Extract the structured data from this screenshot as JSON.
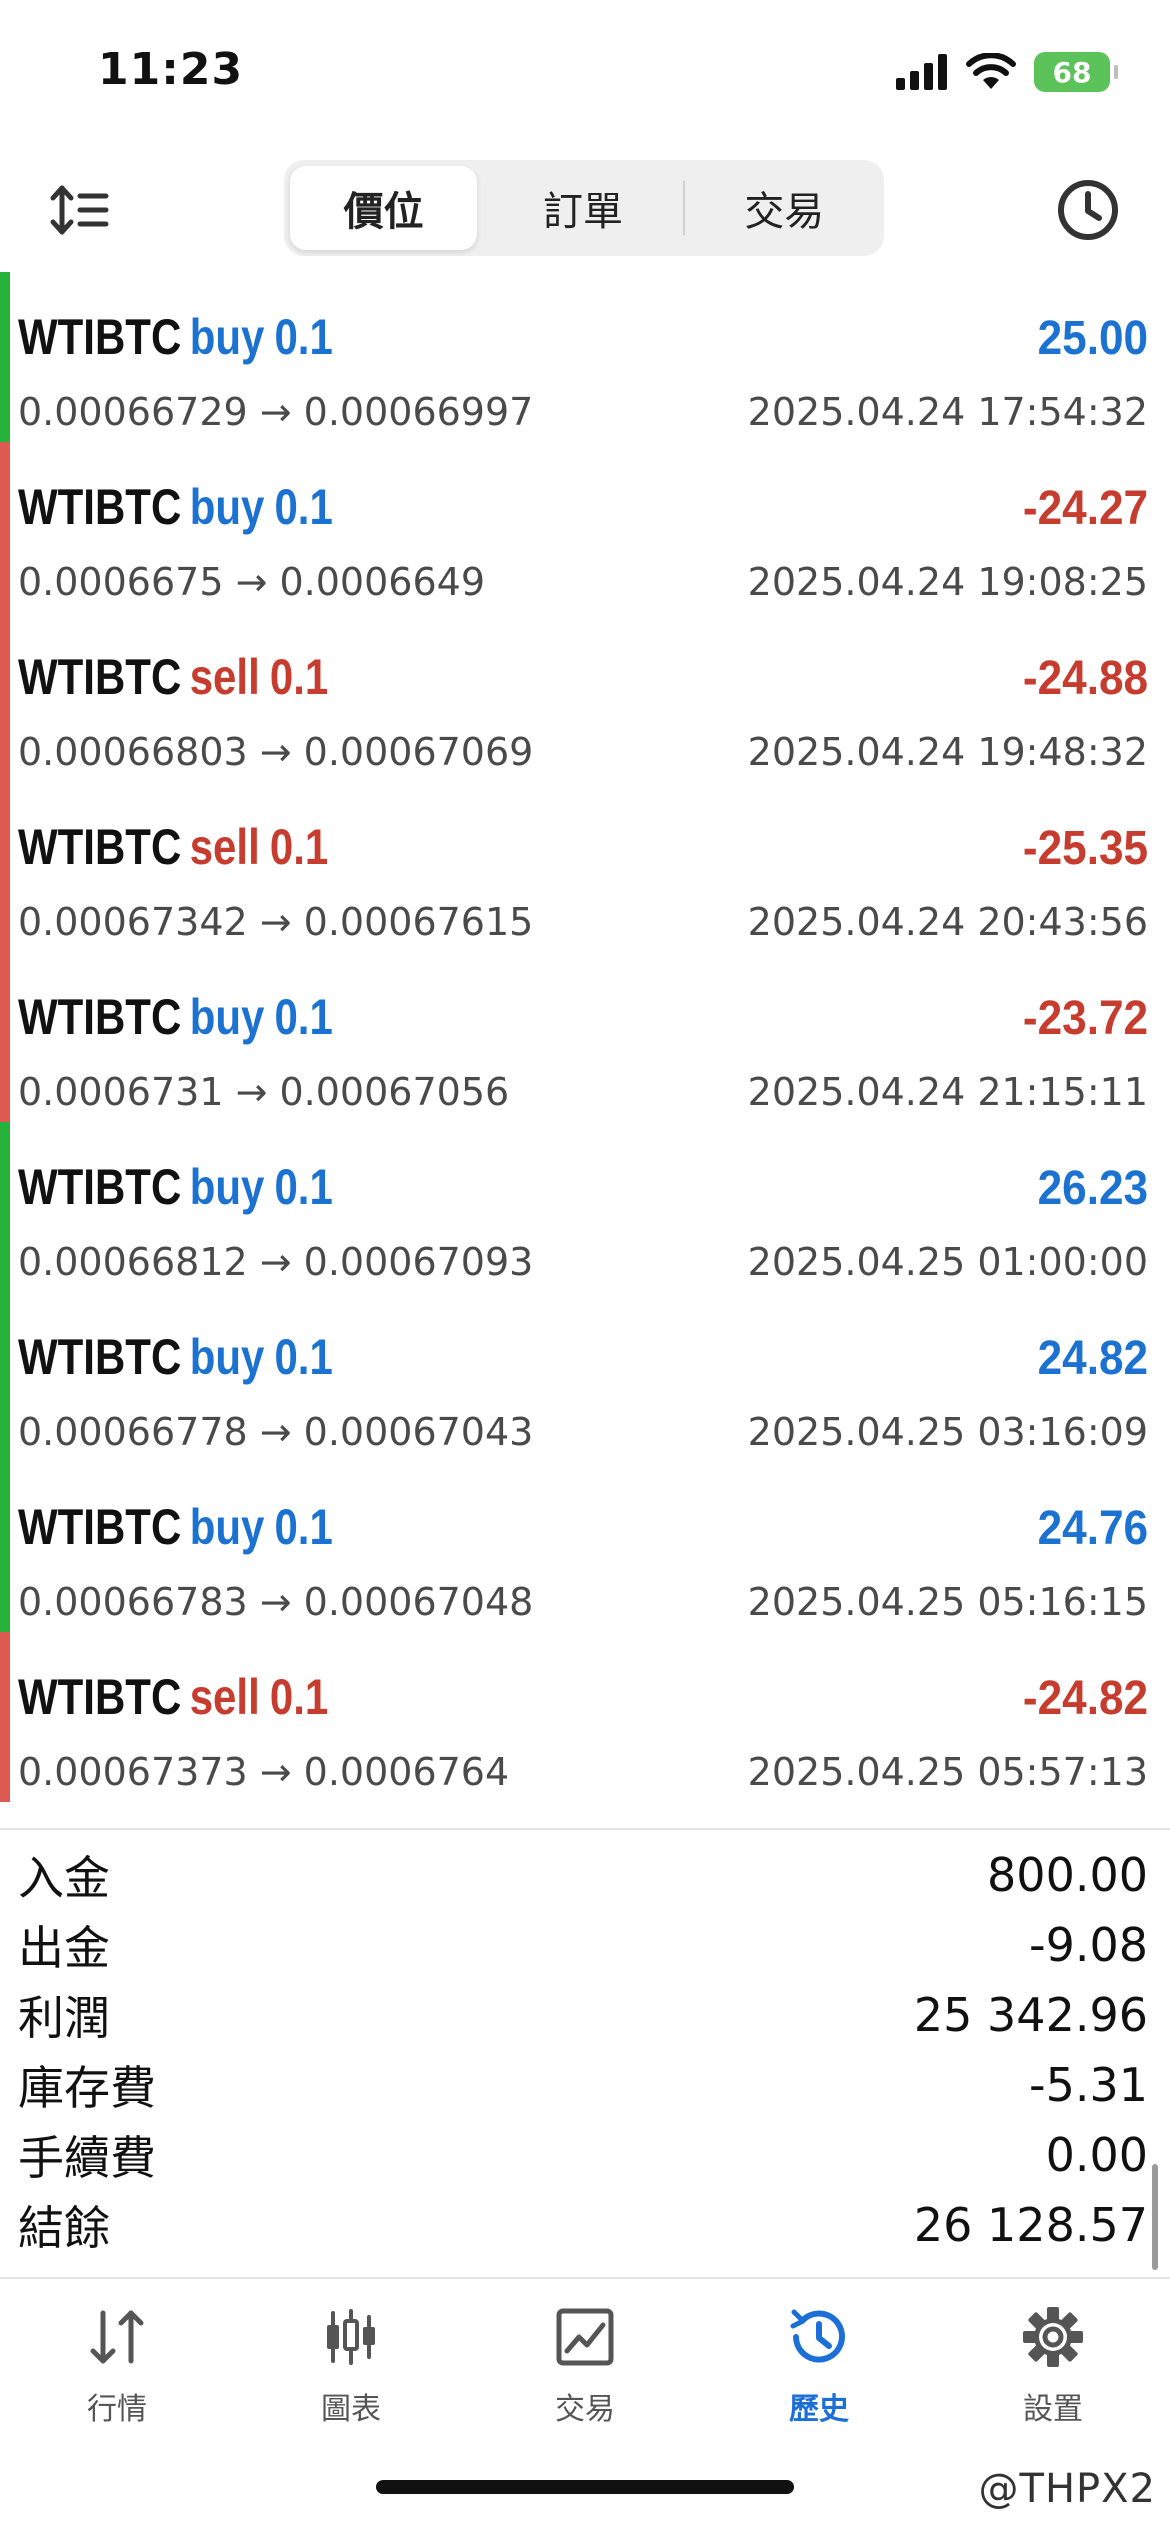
{
  "status_bar": {
    "time": "11:23",
    "battery": "68"
  },
  "tabs": [
    {
      "label": "價位",
      "active": true
    },
    {
      "label": "訂單",
      "active": false
    },
    {
      "label": "交易",
      "active": false
    }
  ],
  "colors": {
    "buy": "#1b72d1",
    "sell": "#c63c2e",
    "profit_pos": "#1b72d1",
    "profit_neg": "#c63c2e",
    "bar_green": "#27b33b",
    "bar_red": "#dc5a50"
  },
  "trades": [
    {
      "symbol": "WTIBTC",
      "side": "buy",
      "volume": "0.1",
      "profit": "25.00",
      "open": "0.00066729",
      "close": "0.00066997",
      "time": "2025.04.24 17:54:32"
    },
    {
      "symbol": "WTIBTC",
      "side": "buy",
      "volume": "0.1",
      "profit": "-24.27",
      "open": "0.0006675",
      "close": "0.0006649",
      "time": "2025.04.24 19:08:25"
    },
    {
      "symbol": "WTIBTC",
      "side": "sell",
      "volume": "0.1",
      "profit": "-24.88",
      "open": "0.00066803",
      "close": "0.00067069",
      "time": "2025.04.24 19:48:32"
    },
    {
      "symbol": "WTIBTC",
      "side": "sell",
      "volume": "0.1",
      "profit": "-25.35",
      "open": "0.00067342",
      "close": "0.00067615",
      "time": "2025.04.24 20:43:56"
    },
    {
      "symbol": "WTIBTC",
      "side": "buy",
      "volume": "0.1",
      "profit": "-23.72",
      "open": "0.0006731",
      "close": "0.00067056",
      "time": "2025.04.24 21:15:11"
    },
    {
      "symbol": "WTIBTC",
      "side": "buy",
      "volume": "0.1",
      "profit": "26.23",
      "open": "0.00066812",
      "close": "0.00067093",
      "time": "2025.04.25 01:00:00"
    },
    {
      "symbol": "WTIBTC",
      "side": "buy",
      "volume": "0.1",
      "profit": "24.82",
      "open": "0.00066778",
      "close": "0.00067043",
      "time": "2025.04.25 03:16:09"
    },
    {
      "symbol": "WTIBTC",
      "side": "buy",
      "volume": "0.1",
      "profit": "24.76",
      "open": "0.00066783",
      "close": "0.00067048",
      "time": "2025.04.25 05:16:15"
    },
    {
      "symbol": "WTIBTC",
      "side": "sell",
      "volume": "0.1",
      "profit": "-24.82",
      "open": "0.00067373",
      "close": "0.0006764",
      "time": "2025.04.25 05:57:13"
    }
  ],
  "summary": [
    {
      "label": "入金",
      "value": "800.00"
    },
    {
      "label": "出金",
      "value": "-9.08"
    },
    {
      "label": "利潤",
      "value": "25 342.96"
    },
    {
      "label": "庫存費",
      "value": "-5.31"
    },
    {
      "label": "手續費",
      "value": "0.00"
    },
    {
      "label": "結餘",
      "value": "26 128.57"
    }
  ],
  "tabbar": [
    {
      "label": "行情",
      "icon": "quotes-arrows-icon",
      "active": false
    },
    {
      "label": "圖表",
      "icon": "candlestick-chart-icon",
      "active": false
    },
    {
      "label": "交易",
      "icon": "trade-chart-icon",
      "active": false
    },
    {
      "label": "歷史",
      "icon": "history-clock-icon",
      "active": true
    },
    {
      "label": "設置",
      "icon": "gear-icon",
      "active": false
    }
  ],
  "watermark": "@THPX2"
}
